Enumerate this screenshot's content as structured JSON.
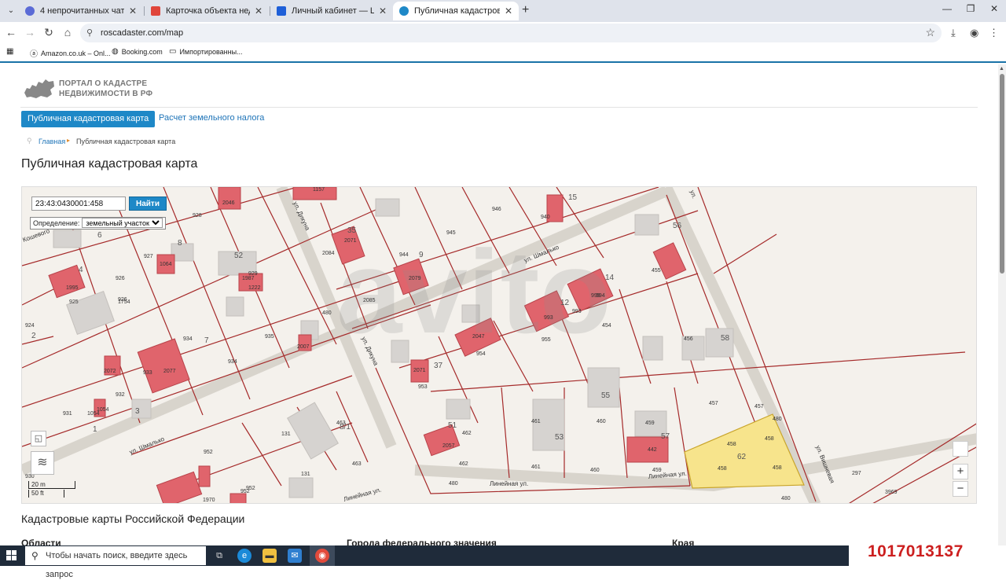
{
  "browser": {
    "tabs": [
      {
        "label": "4 непрочитанных чата",
        "color": "#5b6bd6"
      },
      {
        "label": "Карточка объекта недвижимос",
        "color": "#e0453a"
      },
      {
        "label": "Личный кабинет — ЦИАН",
        "color": "#1e5fd8"
      },
      {
        "label": "Публичная кадастровая карта",
        "color": "#1e88c7"
      }
    ],
    "url": "roscadaster.com/map",
    "bookmarks": [
      "Amazon.co.uk – Onl...",
      "Booking.com",
      "Импортированны..."
    ]
  },
  "site": {
    "logo_line1": "ПОРТАЛ О КАДАСТРЕ",
    "logo_line2": "НЕДВИЖИМОСТИ В РФ",
    "nav": {
      "active": "Публичная кадастровая карта",
      "link": "Расчет земельного налога"
    },
    "breadcrumb": {
      "home": "Главная",
      "current": "Публичная кадастровая карта"
    },
    "title": "Публичная кадастровая карта"
  },
  "map": {
    "search_value": "23:43:0430001:458",
    "search_button": "Найти",
    "definition_label": "Определение:",
    "definition_value": "земельный участок",
    "scale_m": "20 m",
    "scale_ft": "50 ft",
    "zoom_in": "+",
    "zoom_out": "−",
    "watermark": "avito",
    "highlight_color": "#f7e48c",
    "parcel_color": "#a52a2a",
    "building_color": "#e0646c",
    "streets": [
      "ул. Шмалько",
      "ул. Шмалько",
      "ул. Дикуна",
      "ул. Дикуна",
      "Линейная ул.",
      "Линейная ул.",
      "Линейная ул.",
      "ул. Вишневая",
      "Кошевого",
      "ул."
    ],
    "labels": [
      "928",
      "946",
      "945",
      "15",
      "52",
      "929",
      "944",
      "9",
      "6",
      "8",
      "927",
      "4",
      "926",
      "1995",
      "925",
      "2084",
      "2085",
      "2079",
      "35",
      "1222",
      "480",
      "954",
      "7",
      "934",
      "934",
      "935",
      "933",
      "2077",
      "2",
      "924",
      "932",
      "931",
      "3",
      "1",
      "2047",
      "955",
      "993",
      "999",
      "14",
      "455",
      "56",
      "454",
      "456",
      "58",
      "12",
      "37",
      "953",
      "55",
      "457",
      "51",
      "461",
      "460",
      "459",
      "57",
      "462",
      "2057",
      "53",
      "442",
      "462",
      "461",
      "460",
      "459",
      "131",
      "463",
      "952",
      "8/1",
      "131",
      "463",
      "952",
      "480",
      "297",
      "3969",
      "480",
      "62",
      "458",
      "458",
      "458",
      "458",
      "457",
      "480",
      "952",
      "2046",
      "1054",
      "1054",
      "2072",
      "2007",
      "2071",
      "1157",
      "940",
      "926",
      "1754",
      "1970",
      "2071",
      "930",
      "1987",
      "1064",
      "993",
      "994"
    ]
  },
  "page_sections": {
    "title": "Кадастровые карты Российской Федерации",
    "columns": [
      "Области",
      "Города федерального значения",
      "Края"
    ]
  },
  "taskbar": {
    "search_placeholder": "Чтобы начать поиск, введите здесь запрос"
  },
  "overlay_id": "1017013137"
}
